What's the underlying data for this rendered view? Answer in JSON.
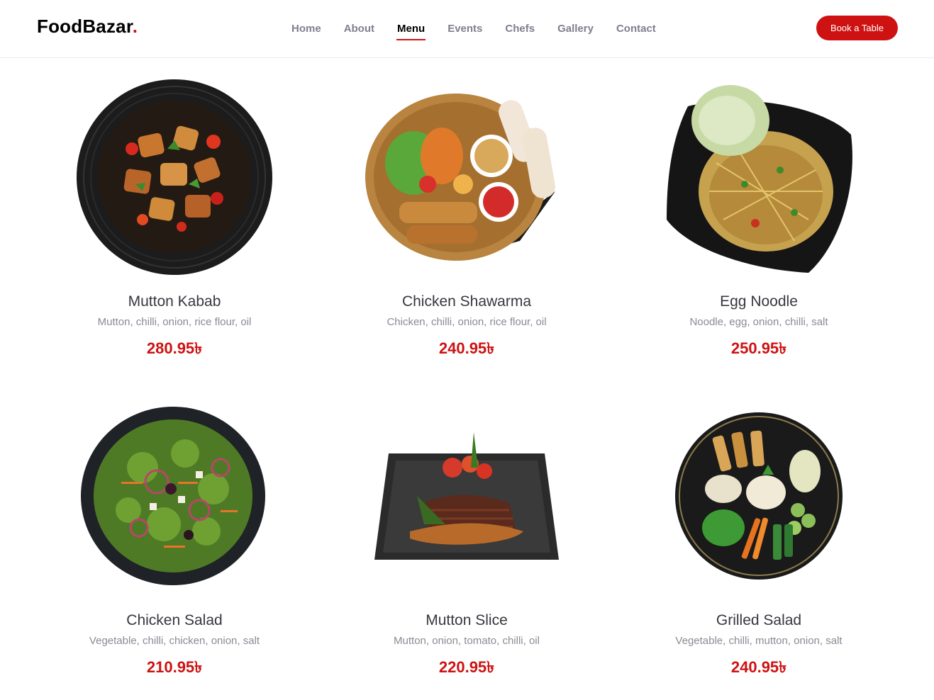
{
  "brand": {
    "name": "FoodBazar",
    "dot": "."
  },
  "nav": {
    "items": [
      "Home",
      "About",
      "Menu",
      "Events",
      "Chefs",
      "Gallery",
      "Contact"
    ],
    "active": "Menu"
  },
  "cta": {
    "label": "Book a Table"
  },
  "colors": {
    "accent": "#ce1212",
    "text": "#37373f",
    "muted": "#8a8a95"
  },
  "menu": {
    "items": [
      {
        "name": "Mutton Kabab",
        "ingredients": "Mutton, chilli, onion, rice flour, oil",
        "price": "280.95৳"
      },
      {
        "name": "Chicken Shawarma",
        "ingredients": "Chicken, chilli, onion, rice flour, oil",
        "price": "240.95৳"
      },
      {
        "name": "Egg Noodle",
        "ingredients": "Noodle, egg, onion, chilli, salt",
        "price": "250.95৳"
      },
      {
        "name": "Chicken Salad",
        "ingredients": "Vegetable, chilli, chicken, onion, salt",
        "price": "210.95৳"
      },
      {
        "name": "Mutton Slice",
        "ingredients": "Mutton, onion, tomato, chilli, oil",
        "price": "220.95৳"
      },
      {
        "name": "Grilled Salad",
        "ingredients": "Vegetable, chilli, mutton, onion, salt",
        "price": "240.95৳"
      }
    ]
  }
}
